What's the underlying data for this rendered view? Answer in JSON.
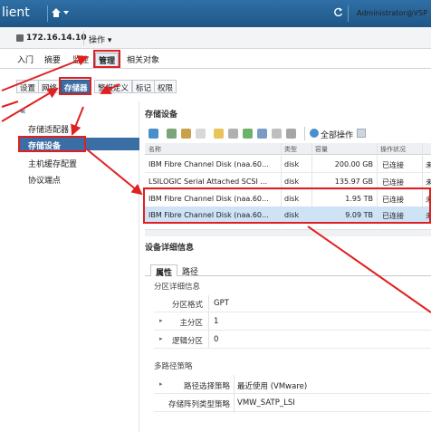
{
  "header": {
    "app_title": "lient",
    "home_icon": "home-icon",
    "refresh_icon": "refresh-icon",
    "user": "Administrator@VSP"
  },
  "hostbar": {
    "host": "172.16.14.10",
    "actions": "操作 ▾"
  },
  "main_tabs": [
    "入门",
    "摘要",
    "监控",
    "管理",
    "相关对象"
  ],
  "sub_tabs": [
    "设置",
    "网络",
    "存储器",
    "警报定义",
    "标记",
    "权限"
  ],
  "left_nav": {
    "items": [
      "存储适配器",
      "存储设备",
      "主机缓存配置",
      "协议端点"
    ],
    "selected": "存储设备"
  },
  "content": {
    "title": "存储设备",
    "all_actions": "全部操作",
    "columns": [
      "名称",
      "类型",
      "容量",
      "操作状况",
      ""
    ],
    "rows": [
      {
        "name": "IBM Fibre Channel Disk (naa.60...",
        "type": "disk",
        "capacity": "200.00 GB",
        "status": "已连接",
        "extra": "未"
      },
      {
        "name": "LSILOGIC Serial Attached SCSI ...",
        "type": "disk",
        "capacity": "135.97 GB",
        "status": "已连接",
        "extra": "未"
      },
      {
        "name": "IBM Fibre Channel Disk (naa.60...",
        "type": "disk",
        "capacity": "1.95 TB",
        "status": "已连接",
        "extra": "未"
      },
      {
        "name": "IBM Fibre Channel Disk (naa.60...",
        "type": "disk",
        "capacity": "9.09 TB",
        "status": "已连接",
        "extra": "未"
      }
    ]
  },
  "details": {
    "title": "设备详细信息",
    "tabs": [
      "属性",
      "路径"
    ],
    "partition_header": "分区详细信息",
    "partition_format_label": "分区格式",
    "partition_format": "GPT",
    "primary_label": "主分区",
    "primary": "1",
    "logical_label": "逻辑分区",
    "logical": "0",
    "multipath_header": "多路径策略",
    "path_policy_label": "路径选择策略",
    "path_policy": "最近使用 (VMware)",
    "satp_label": "存储阵列类型策略",
    "satp": "VMW_SATP_LSI"
  },
  "colors": {
    "header": "#2f6fa6",
    "selected": "#3a6ea5",
    "annotation": "#e02020"
  }
}
